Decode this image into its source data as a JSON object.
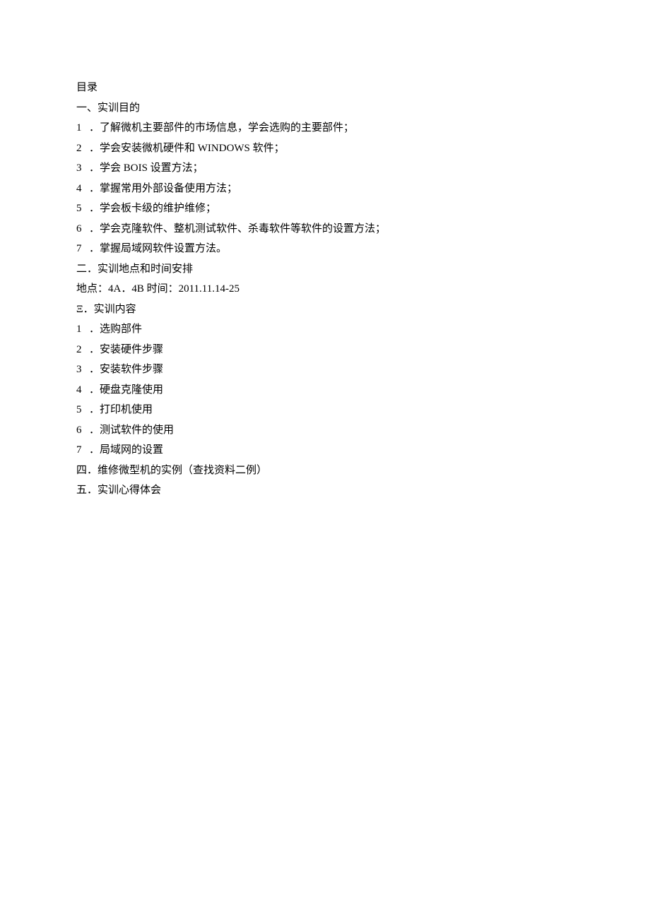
{
  "toc_title": "目录",
  "section1": {
    "heading": "一、实训目的",
    "items": [
      {
        "num": "1",
        "text": "．了解微机主要部件的市场信息，学会选购的主要部件；"
      },
      {
        "num": "2",
        "text": "．学会安装微机硬件和 WINDOWS 软件；"
      },
      {
        "num": "3",
        "text": "．学会 BOIS 设置方法；"
      },
      {
        "num": "4",
        "text": "．掌握常用外部设备使用方法；"
      },
      {
        "num": "5",
        "text": "．学会板卡级的维护维修；"
      },
      {
        "num": "6",
        "text": "．学会克隆软件、整机测试软件、杀毒软件等软件的设置方法；"
      },
      {
        "num": "7",
        "text": "．掌握局域网软件设置方法。"
      }
    ]
  },
  "section2": {
    "heading": "二．实训地点和时间安排",
    "detail": "地点：4A．4B 时间：2011.11.14-25"
  },
  "section3": {
    "heading": "Ξ．实训内容",
    "items": [
      {
        "num": "1",
        "text": "．选购部件"
      },
      {
        "num": "2",
        "text": "．安装硬件步骤"
      },
      {
        "num": "3",
        "text": "．安装软件步骤"
      },
      {
        "num": "4",
        "text": "．硬盘克隆使用"
      },
      {
        "num": "5",
        "text": "．打印机使用"
      },
      {
        "num": "6",
        "text": "．测试软件的使用"
      },
      {
        "num": "7",
        "text": "．局域网的设置"
      }
    ]
  },
  "section4": {
    "heading": "四．维修微型机的实例（查找资料二例）"
  },
  "section5": {
    "heading": "五．实训心得体会"
  }
}
